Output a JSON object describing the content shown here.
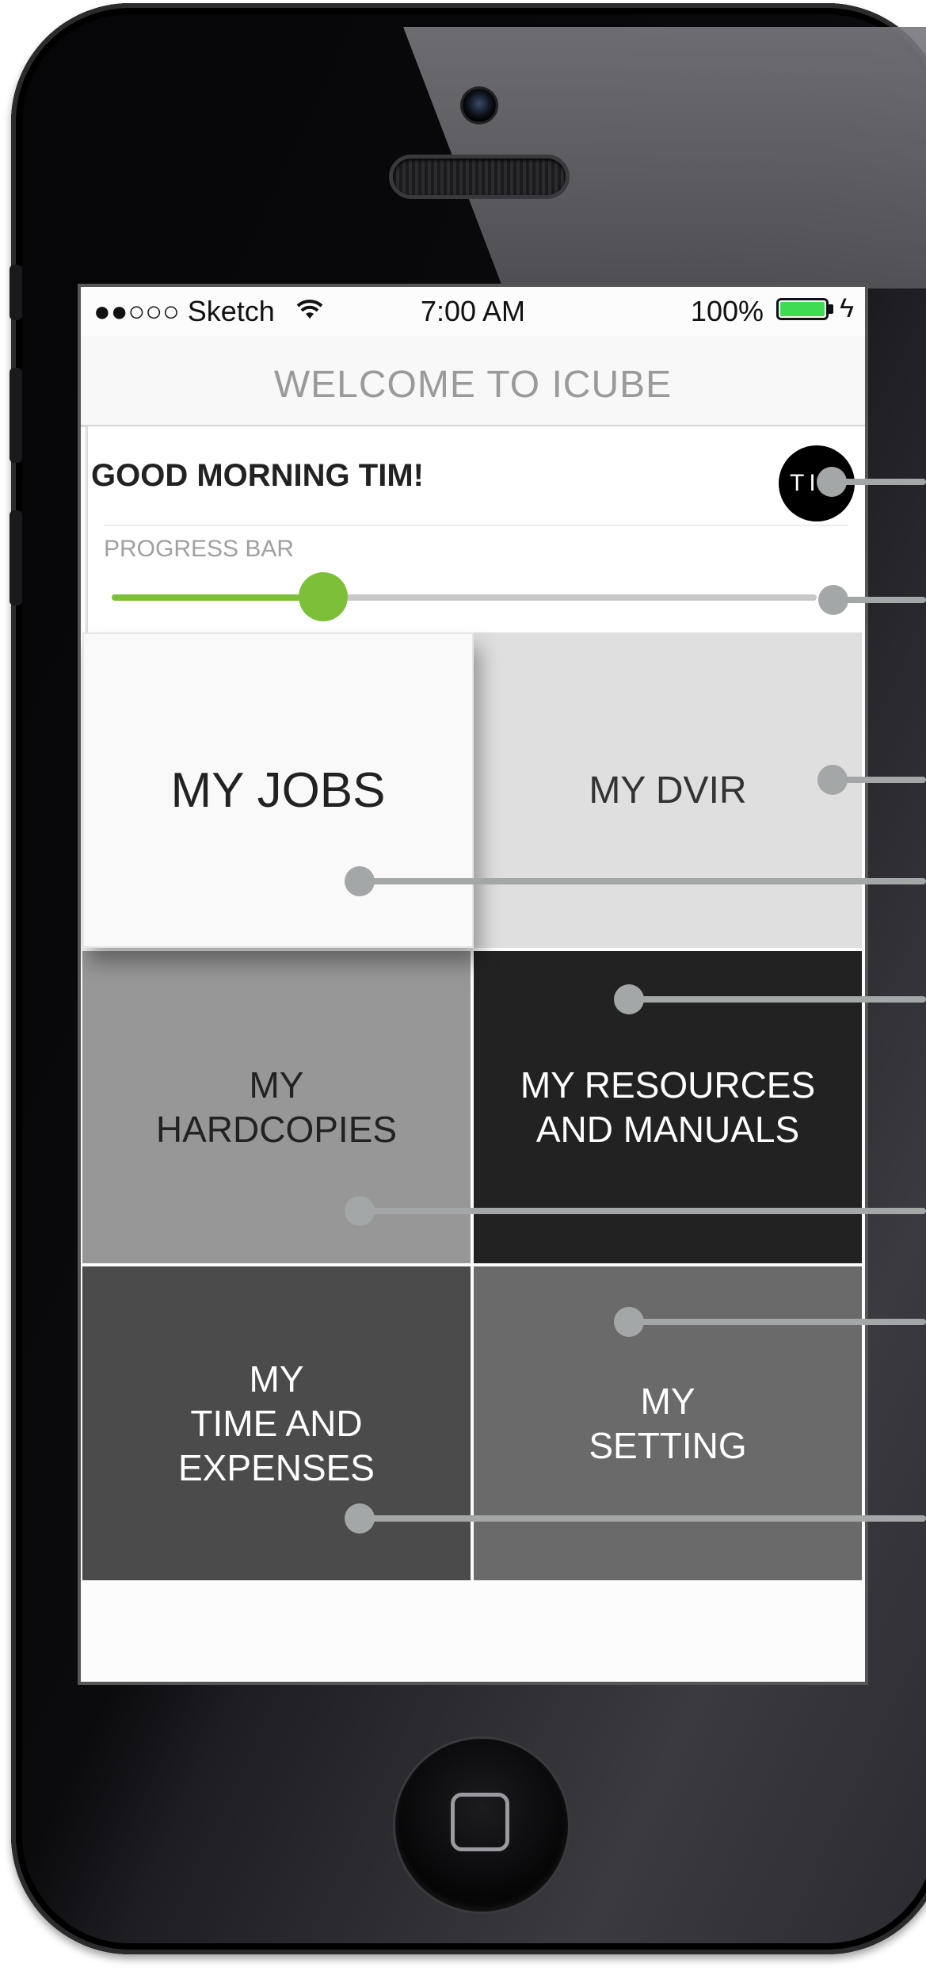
{
  "status_bar": {
    "carrier": "●●○○○ Sketch",
    "time": "7:00 AM",
    "battery_percent": "100%",
    "battery_level": 1.0,
    "battery_color": "#3ddc53"
  },
  "nav": {
    "title": "WELCOME TO ICUBE"
  },
  "greeting": {
    "text": "GOOD MORNING TIM!",
    "avatar_initials": "TIM"
  },
  "progress": {
    "label": "PROGRESS BAR",
    "value": 0.3,
    "color": "#7cc03a"
  },
  "tiles": {
    "jobs": "MY JOBS",
    "dvir": "MY DVIR",
    "hardcopies": "MY\nHARDCOPIES",
    "resources": "MY RESOURCES\nAND MANUALS",
    "time_expenses": "MY\nTIME AND\nEXPENSES",
    "setting": "MY\nSETTING"
  }
}
